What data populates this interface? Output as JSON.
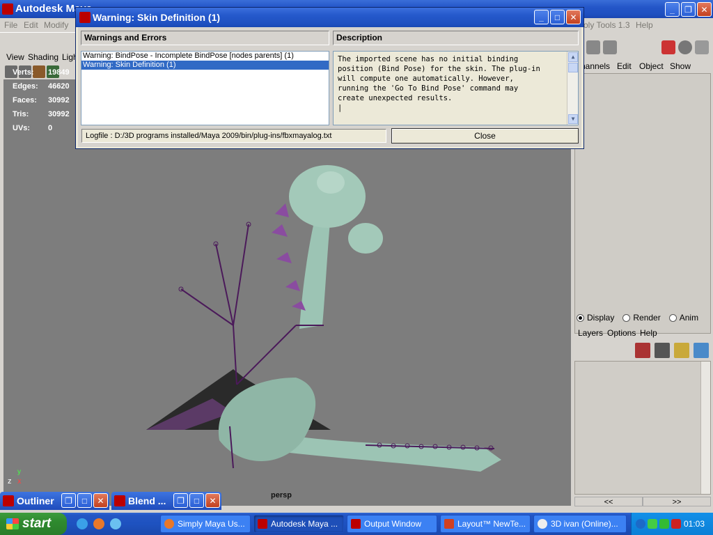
{
  "maya_window": {
    "title": "Autodesk Maya",
    "menu": [
      "File",
      "Edit",
      "Modify"
    ],
    "menu_right": [
      "oly Tools 1.3",
      "Help"
    ]
  },
  "viewport": {
    "menu": [
      "View",
      "Shading",
      "Ligh"
    ],
    "camera_label": "persp",
    "stats": [
      {
        "label": "Verts:",
        "value": "19849"
      },
      {
        "label": "Edges:",
        "value": "46620"
      },
      {
        "label": "Faces:",
        "value": "30992"
      },
      {
        "label": "Tris:",
        "value": "30992"
      },
      {
        "label": "UVs:",
        "value": "0"
      }
    ],
    "axis": {
      "z": "z",
      "x": "x",
      "y": "y"
    }
  },
  "channel_box": {
    "menu": [
      "hannels",
      "Edit",
      "Object",
      "Show"
    ]
  },
  "layer_editor": {
    "modes": [
      {
        "label": "Display",
        "selected": true
      },
      {
        "label": "Render",
        "selected": false
      },
      {
        "label": "Anim",
        "selected": false
      }
    ],
    "menu": [
      "Layers",
      "Options",
      "Help"
    ],
    "nav": [
      "<<",
      ">>"
    ]
  },
  "minimized_panels": [
    {
      "title": "Outliner"
    },
    {
      "title": "Blend ..."
    }
  ],
  "dialog": {
    "title": "Warning: Skin Definition (1)",
    "col_warnings": "Warnings and Errors",
    "col_description": "Description",
    "warnings": [
      {
        "text": "Warning: BindPose - Incomplete BindPose [nodes parents] (1)",
        "selected": false
      },
      {
        "text": "Warning: Skin Definition (1)",
        "selected": true
      }
    ],
    "description": "The imported scene has no initial binding\nposition (Bind Pose) for the skin. The plug-in\nwill compute one automatically. However,\nrunning the 'Go To Bind Pose' command may\ncreate unexpected results.\n|",
    "logfile": "Logfile : D:/3D programs installed/Maya 2009/bin/plug-ins/fbxmayalog.txt",
    "close_label": "Close"
  },
  "taskbar": {
    "start_label": "start",
    "tasks": [
      {
        "label": "Simply Maya Us...",
        "active": false
      },
      {
        "label": "Autodesk Maya ...",
        "active": true
      },
      {
        "label": "Output Window",
        "active": false
      },
      {
        "label": "Layout™ NewTe...",
        "active": false
      },
      {
        "label": "3D ivan (Online)...",
        "active": false
      }
    ],
    "clock": "01:03"
  },
  "colors": {
    "titlebar_blue": "#245ad0",
    "viewport_gray": "#7d7d7d",
    "model_green": "#9cc4b4",
    "skeleton_purple": "#6a2a7a",
    "selection_blue": "#316ac5"
  }
}
